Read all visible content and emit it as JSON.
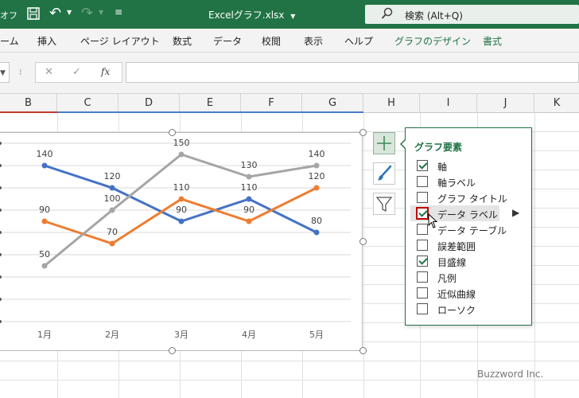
{
  "titlebar": {
    "autosave_fragment": "オフ",
    "undo_label": "↶",
    "doc_title": "Excelグラフ.xlsx",
    "search_placeholder": "検索 (Alt+Q)"
  },
  "ribbon": {
    "tabs": [
      "ーム",
      "挿入",
      "ページ レイアウト",
      "数式",
      "データ",
      "校閲",
      "表示",
      "ヘルプ",
      "グラフのデザイン",
      "書式"
    ]
  },
  "formula_bar": {
    "fx_label": "fx",
    "value": ""
  },
  "columns": [
    "B",
    "C",
    "D",
    "E",
    "F",
    "G",
    "H",
    "I",
    "J",
    "K"
  ],
  "chart_data": {
    "type": "line",
    "categories": [
      "1月",
      "2月",
      "3月",
      "4月",
      "5月"
    ],
    "series": [
      {
        "values": [
          140,
          120,
          90,
          110,
          80
        ],
        "color": "#4472c4"
      },
      {
        "values": [
          90,
          70,
          110,
          90,
          120
        ],
        "color": "#ed7d31"
      },
      {
        "values": [
          50,
          100,
          150,
          130,
          140
        ],
        "color": "#a5a5a5"
      }
    ],
    "data_labels": true,
    "ylim": [
      0,
      160
    ],
    "grid": true,
    "legend": "none"
  },
  "elements_panel": {
    "title": "グラフ要素",
    "items": [
      {
        "label": "軸",
        "checked": true
      },
      {
        "label": "軸ラベル",
        "checked": false
      },
      {
        "label": "グラフ タイトル",
        "checked": false
      },
      {
        "label": "データ ラベル",
        "checked": true
      },
      {
        "label": "データ テーブル",
        "checked": false
      },
      {
        "label": "誤差範囲",
        "checked": false
      },
      {
        "label": "目盛線",
        "checked": true
      },
      {
        "label": "凡例",
        "checked": false
      },
      {
        "label": "近似曲線",
        "checked": false
      },
      {
        "label": "ローソク",
        "checked": false
      }
    ]
  },
  "watermark": "Buzzword Inc."
}
